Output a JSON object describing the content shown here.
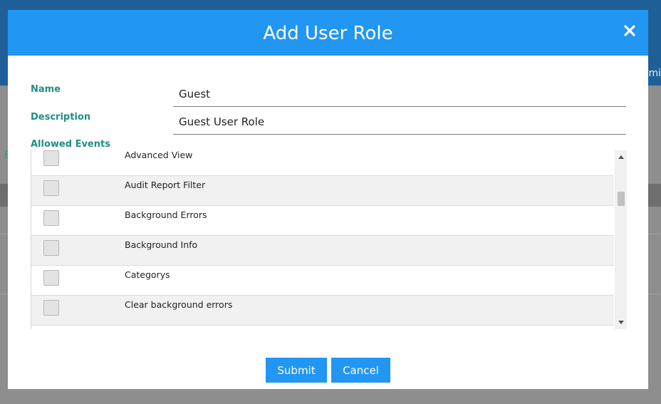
{
  "background": {
    "left_fragment": "",
    "right_fragment": "mi",
    "side_fragment": "E"
  },
  "modal": {
    "title": "Add User Role",
    "fields": {
      "name_label": "Name",
      "name_value": "Guest",
      "description_label": "Description",
      "description_value": "Guest User Role",
      "allowed_events_label": "Allowed Events"
    },
    "events": [
      {
        "label": "Advanced View",
        "checked": false
      },
      {
        "label": "Audit Report Filter",
        "checked": false
      },
      {
        "label": "Background Errors",
        "checked": false
      },
      {
        "label": "Background Info",
        "checked": false
      },
      {
        "label": "Categorys",
        "checked": false
      },
      {
        "label": "Clear background errors",
        "checked": false
      }
    ],
    "buttons": {
      "submit": "Submit",
      "cancel": "Cancel"
    }
  },
  "colors": {
    "accent": "#2196f3",
    "label": "#1e8f86"
  }
}
